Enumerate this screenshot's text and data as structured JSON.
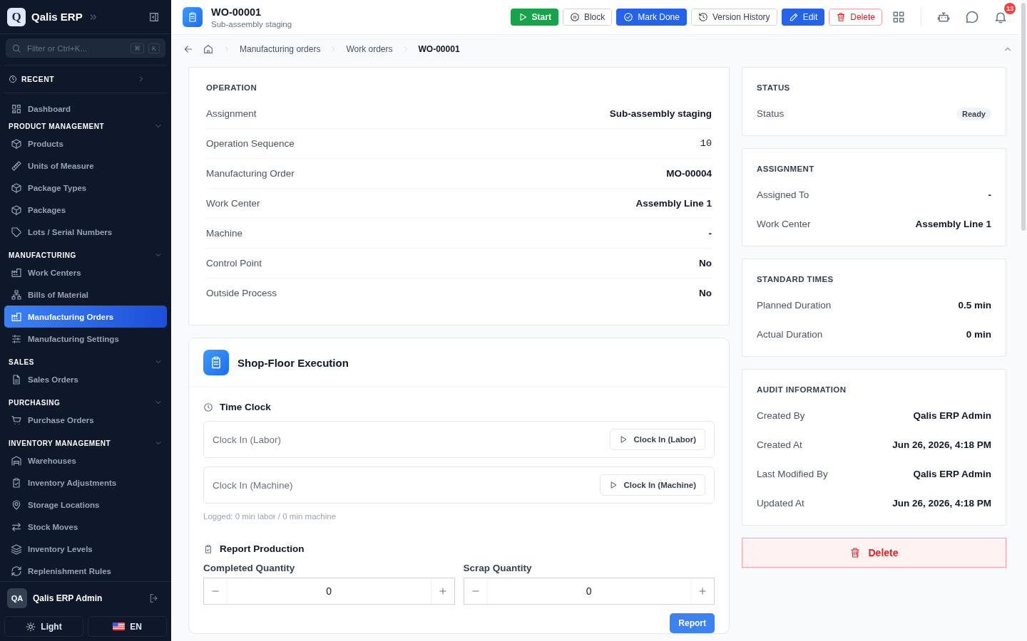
{
  "app": {
    "name": "Qalis ERP",
    "logo_letter": "Q"
  },
  "sidebar": {
    "search": {
      "placeholder": "Filter or Ctrl+K...",
      "keys": [
        "⌘",
        "K"
      ]
    },
    "recent": {
      "label": "RECENT",
      "expanded": false
    },
    "sections": [
      {
        "items": [
          {
            "label": "Dashboard",
            "selected": false
          }
        ]
      },
      {
        "title": "PRODUCT MANAGEMENT",
        "expanded": true,
        "items": [
          {
            "label": "Products",
            "selected": false
          },
          {
            "label": "Units of Measure",
            "selected": false
          },
          {
            "label": "Package Types",
            "selected": false
          },
          {
            "label": "Packages",
            "selected": false
          },
          {
            "label": "Lots / Serial Numbers",
            "selected": false
          }
        ]
      },
      {
        "title": "MANUFACTURING",
        "expanded": true,
        "items": [
          {
            "label": "Work Centers",
            "selected": false
          },
          {
            "label": "Bills of Material",
            "selected": false
          },
          {
            "label": "Manufacturing Orders",
            "selected": true
          },
          {
            "label": "Manufacturing Settings",
            "selected": false
          }
        ]
      },
      {
        "title": "SALES",
        "expanded": true,
        "items": [
          {
            "label": "Sales Orders",
            "selected": false
          }
        ]
      },
      {
        "title": "PURCHASING",
        "expanded": true,
        "items": [
          {
            "label": "Purchase Orders",
            "selected": false
          }
        ]
      },
      {
        "title": "INVENTORY MANAGEMENT",
        "expanded": true,
        "items": [
          {
            "label": "Warehouses",
            "selected": false
          },
          {
            "label": "Inventory Adjustments",
            "selected": false
          },
          {
            "label": "Storage Locations",
            "selected": false
          },
          {
            "label": "Stock Moves",
            "selected": false
          },
          {
            "label": "Inventory Levels",
            "selected": false
          },
          {
            "label": "Replenishment Rules",
            "selected": false
          }
        ]
      }
    ],
    "user": {
      "initials": "QA",
      "name": "Qalis ERP Admin"
    },
    "theme_button": "Light",
    "language_button": "EN"
  },
  "header": {
    "title": "WO-00001",
    "subtitle": "Sub-assembly staging",
    "actions": [
      {
        "label": "Start",
        "kind": "success"
      },
      {
        "label": "Block",
        "kind": "outline"
      },
      {
        "label": "Mark Done",
        "kind": "primary"
      },
      {
        "label": "Version History",
        "kind": "outline"
      },
      {
        "label": "Edit",
        "kind": "primary"
      },
      {
        "label": "Delete",
        "kind": "danger"
      }
    ],
    "notification_count": "13"
  },
  "breadcrumb": [
    {
      "label": "Manufacturing orders",
      "current": false
    },
    {
      "label": "Work orders",
      "current": false
    },
    {
      "label": "WO-00001",
      "current": true
    }
  ],
  "operation": {
    "title": "OPERATION",
    "rows": [
      {
        "label": "Assignment",
        "value": "Sub-assembly staging",
        "kind": "text"
      },
      {
        "label": "Operation Sequence",
        "value": "10",
        "kind": "code"
      },
      {
        "label": "Manufacturing Order",
        "value": "MO-00004",
        "kind": "text"
      },
      {
        "label": "Work Center",
        "value": "Assembly Line 1",
        "kind": "text"
      },
      {
        "label": "Machine",
        "value": "-",
        "kind": "text"
      },
      {
        "label": "Control Point",
        "value": "No",
        "kind": "text"
      },
      {
        "label": "Outside Process",
        "value": "No",
        "kind": "text"
      }
    ]
  },
  "execution": {
    "title": "Shop-Floor Execution",
    "time_clock": {
      "title": "Time Clock",
      "rows": [
        {
          "label": "Clock In (Labor)",
          "button": "Clock In (Labor)"
        },
        {
          "label": "Clock In (Machine)",
          "button": "Clock In (Machine)"
        }
      ],
      "logged": "Logged: 0 min labor / 0 min machine"
    },
    "report": {
      "title": "Report Production",
      "fields": [
        {
          "label": "Completed Quantity",
          "value": "0"
        },
        {
          "label": "Scrap Quantity",
          "value": "0"
        }
      ],
      "button": "Report"
    }
  },
  "side_cards": [
    {
      "title": "STATUS",
      "rows": [
        {
          "label": "Status",
          "value": "Ready",
          "kind": "badge"
        }
      ]
    },
    {
      "title": "ASSIGNMENT",
      "rows": [
        {
          "label": "Assigned To",
          "value": "-",
          "kind": "text"
        },
        {
          "label": "Work Center",
          "value": "Assembly Line 1",
          "kind": "text"
        }
      ]
    },
    {
      "title": "STANDARD TIMES",
      "rows": [
        {
          "label": "Planned Duration",
          "value": "0.5 min",
          "kind": "text"
        },
        {
          "label": "Actual Duration",
          "value": "0 min",
          "kind": "text"
        }
      ]
    },
    {
      "title": "AUDIT INFORMATION",
      "rows": [
        {
          "label": "Created By",
          "value": "Qalis ERP Admin",
          "kind": "text"
        },
        {
          "label": "Created At",
          "value": "Jun 26, 2026, 4:18 PM",
          "kind": "text"
        },
        {
          "label": "Last Modified By",
          "value": "Qalis ERP Admin",
          "kind": "text"
        },
        {
          "label": "Updated At",
          "value": "Jun 26, 2026, 4:18 PM",
          "kind": "text"
        }
      ]
    }
  ],
  "delete_button": "Delete"
}
